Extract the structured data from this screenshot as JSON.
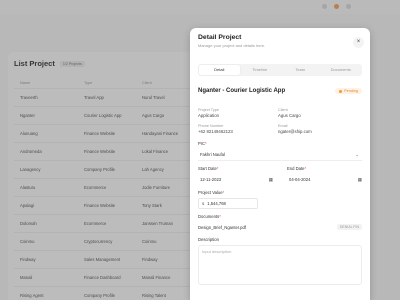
{
  "list": {
    "title": "List Project",
    "count": "1/2 Projects",
    "columns": [
      "Name",
      "Type",
      "Client"
    ],
    "rows": [
      [
        "Traveerth",
        "Travel App",
        "Nurul Travel"
      ],
      [
        "Nganter",
        "Courier Logistic App",
        "Agus Cargo"
      ],
      [
        "Alunuang",
        "Finance Website",
        "Handayani Finance"
      ],
      [
        "Andromeda",
        "Finance Website",
        "Lokal Finance"
      ],
      [
        "Lanagency",
        "Company Profile",
        "Lah Agency"
      ],
      [
        "Alasturu",
        "Ecommerce",
        "Jodie Furniture"
      ],
      [
        "Apalagi",
        "Finance Website",
        "Tony Stark"
      ],
      [
        "Dolomah",
        "Ecommerce",
        "Janssen Truman"
      ],
      [
        "Coinmu",
        "Cryptocurrency",
        "Coinmu"
      ],
      [
        "Findway",
        "Sales Management",
        "Findway"
      ],
      [
        "Manali",
        "Finance Dashboard",
        "Manali Finance"
      ],
      [
        "Rising Agent",
        "Company Profile",
        "Rising Talent"
      ]
    ]
  },
  "drawer": {
    "title": "Detail Project",
    "subtitle": "Manage your project and details here.",
    "close": "×",
    "tabs": [
      "Detail",
      "Timeline",
      "Team",
      "Documents"
    ],
    "project_name": "Nganter - Courier Logistic App",
    "status": "Pending",
    "info": {
      "type_label": "Project Type",
      "type_value": "Application",
      "client_label": "Client",
      "client_value": "Agus Cargo",
      "phone_label": "Phone Number",
      "phone_value": "+62 82149462123",
      "email_label": "Email",
      "email_value": "ngater@ship.com"
    },
    "pic_label": "PIC",
    "pic_value": "Fakhri Naufal",
    "start_label": "Start Date",
    "start_value": "12-11-2023",
    "end_label": "End Date",
    "end_value": "04-04-2024",
    "value_label": "Project Value",
    "value_amount": "1,544,768",
    "documents_label": "Documents",
    "document_name": "Design_Brief_Nganter.pdf",
    "document_size": "DENIAL FIN",
    "description_label": "Description",
    "description_placeholder": "Input description"
  },
  "icons": {
    "close": "close-icon",
    "chevron": "chevron-down-icon",
    "calendar": "calendar-icon",
    "money": "money-icon"
  },
  "colors": {
    "pending": "#e08a2a",
    "required": "#e24a4a"
  }
}
